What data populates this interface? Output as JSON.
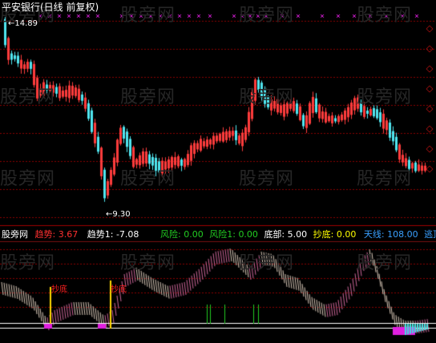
{
  "title": "平安银行(日线 前复权)",
  "price_high_label": "14.89",
  "price_low_label": "9.30",
  "indicator": {
    "brand": "股旁网",
    "items": [
      {
        "label": "趋势:",
        "value": "3.67",
        "label_color": "#ff3030",
        "value_color": "#ff3030"
      },
      {
        "label": "趋势1:",
        "value": "-7.08",
        "label_color": "#ffffff",
        "value_color": "#ffffff"
      },
      {
        "label": "风险:",
        "value": "0.00",
        "label_color": "#22cc22",
        "value_color": "#22cc22"
      },
      {
        "label": "风险1:",
        "value": "0.00",
        "label_color": "#22cc22",
        "value_color": "#22cc22"
      },
      {
        "label": "底部:",
        "value": "5.00",
        "label_color": "#ffffff",
        "value_color": "#ffffff"
      },
      {
        "label": "抄底:",
        "value": "0.00",
        "label_color": "#ffff00",
        "value_color": "#ffff00"
      },
      {
        "label": "天线:",
        "value": "108.00",
        "label_color": "#3aa0ff",
        "value_color": "#3aa0ff"
      },
      {
        "label": "逃顶",
        "value": "",
        "label_color": "#3aa0ff",
        "value_color": "#3aa0ff"
      }
    ]
  },
  "chaodi_marks": [
    "抄底",
    "抄底"
  ],
  "watermark": "股旁网",
  "colors": {
    "up": "#ff3c3c",
    "down": "#50e6f0",
    "grid": "#8b0000",
    "gold": "#ffd700",
    "bull": "#cc6699",
    "bear": "#d8c8b8"
  }
}
